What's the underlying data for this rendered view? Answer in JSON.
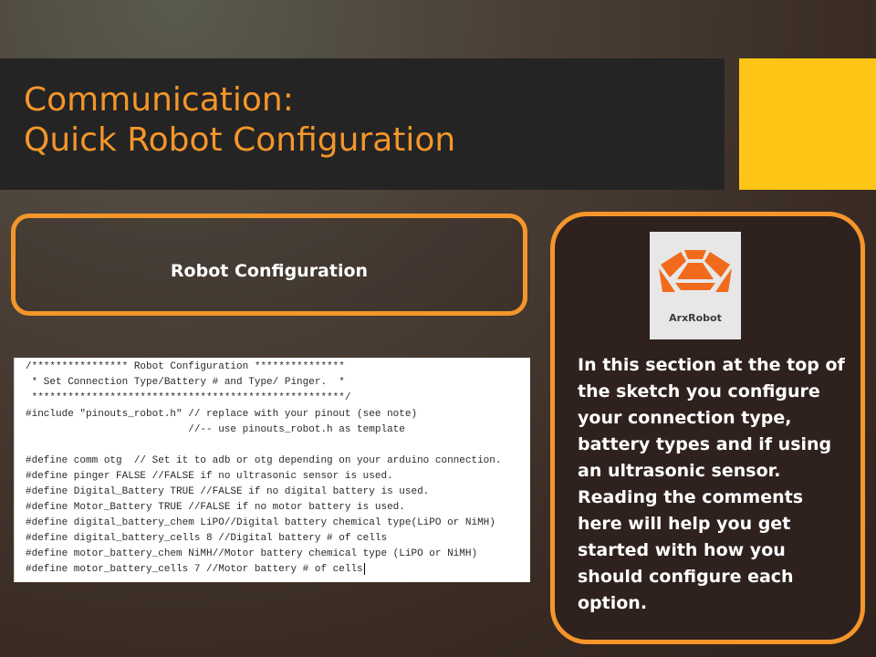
{
  "title": {
    "line1": "Communication:",
    "line2": "Quick Robot Configuration"
  },
  "left_box": {
    "label": "Robot Configuration"
  },
  "code_lines": [
    "/**************** Robot Configuration ***************",
    " * Set Connection Type/Battery # and Type/ Pinger.  *",
    " ****************************************************/",
    "#include \"pinouts_robot.h\" // replace with your pinout (see note)",
    "                           //-- use pinouts_robot.h as template",
    "",
    "#define comm otg  // Set it to adb or otg depending on your arduino connection.",
    "#define pinger FALSE //FALSE if no ultrasonic sensor is used.",
    "#define Digital_Battery TRUE //FALSE if no digital battery is used.",
    "#define Motor_Battery TRUE //FALSE if no motor battery is used.",
    "#define digital_battery_chem LiPO//Digital battery chemical type(LiPO or NiMH)",
    "#define digital_battery_cells 8 //Digital battery # of cells",
    "#define motor_battery_chem NiMH//Motor battery chemical type (LiPO or NiMH)",
    "#define motor_battery_cells 7 //Motor battery # of cells"
  ],
  "logo": {
    "text": "ArxRobot",
    "color": "#f26b1d"
  },
  "description": "In this section at the top of the sketch you configure your connection type, battery types and if using an ultrasonic sensor. Reading the comments here will help you get started with how you should configure each option.",
  "colors": {
    "accent_orange": "#f4962a",
    "accent_yellow": "#fdc516",
    "title_bar": "#242424"
  }
}
